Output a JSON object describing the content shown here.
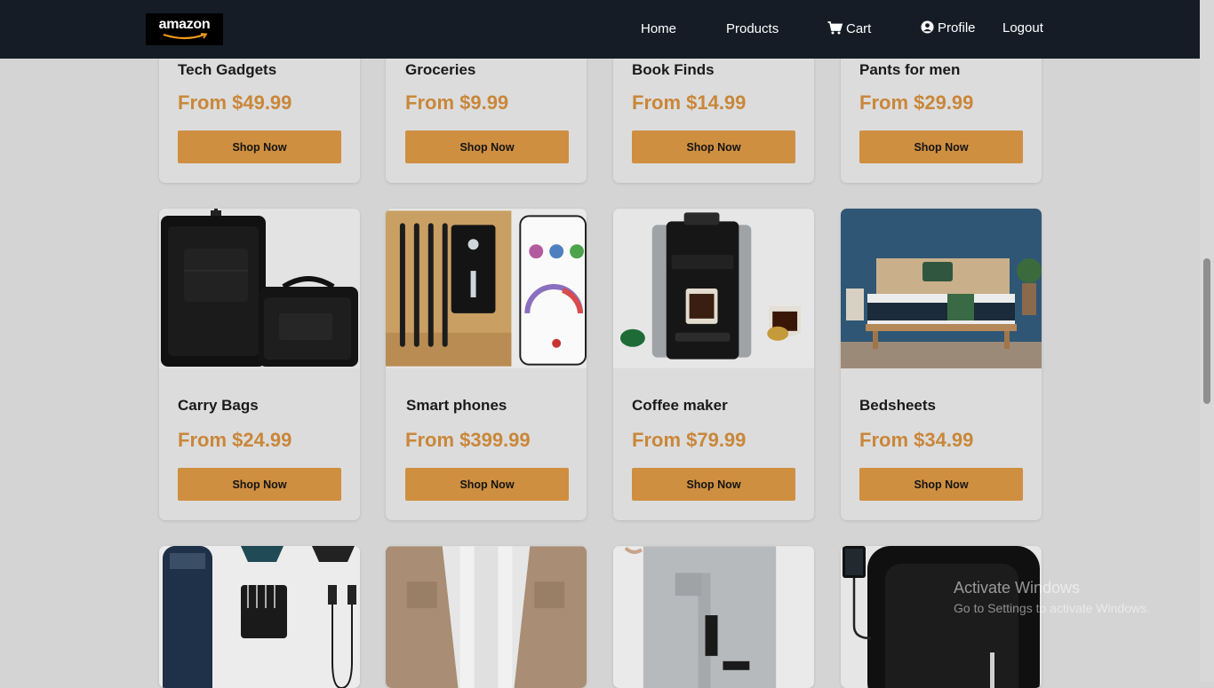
{
  "brand": {
    "logo_text": "amazon"
  },
  "nav": {
    "home": "Home",
    "products": "Products",
    "cart": "Cart",
    "profile": "Profile",
    "logout": "Logout"
  },
  "cards": [
    {
      "title": "Tech Gadgets",
      "price": "From $49.99",
      "button": "Shop Now"
    },
    {
      "title": "Groceries",
      "price": "From $9.99",
      "button": "Shop Now"
    },
    {
      "title": "Book Finds",
      "price": "From $14.99",
      "button": "Shop Now"
    },
    {
      "title": "Pants for men",
      "price": "From $29.99",
      "button": "Shop Now"
    },
    {
      "title": "Carry Bags",
      "price": "From $24.99",
      "button": "Shop Now",
      "image": "luggage-set"
    },
    {
      "title": "Smart phones",
      "price": "From $399.99",
      "button": "Shop Now",
      "image": "meat-thermometer-app"
    },
    {
      "title": "Coffee maker",
      "price": "From $79.99",
      "button": "Shop Now",
      "image": "espresso-machine"
    },
    {
      "title": "Bedsheets",
      "price": "From $34.99",
      "button": "Shop Now",
      "image": "bed-mattress"
    },
    {
      "image": "hair-trimmer-kit"
    },
    {
      "image": "men-shirt"
    },
    {
      "image": "cargo-pants"
    },
    {
      "image": "backpack"
    }
  ],
  "watermark": {
    "title": "Activate Windows",
    "subtitle": "Go to Settings to activate Windows."
  },
  "colors": {
    "navbar": "#151c26",
    "accent_button": "#cf8f40",
    "price": "#c9873a",
    "card_bg": "#dcdcdc",
    "page_bg": "#d4d4d4"
  }
}
